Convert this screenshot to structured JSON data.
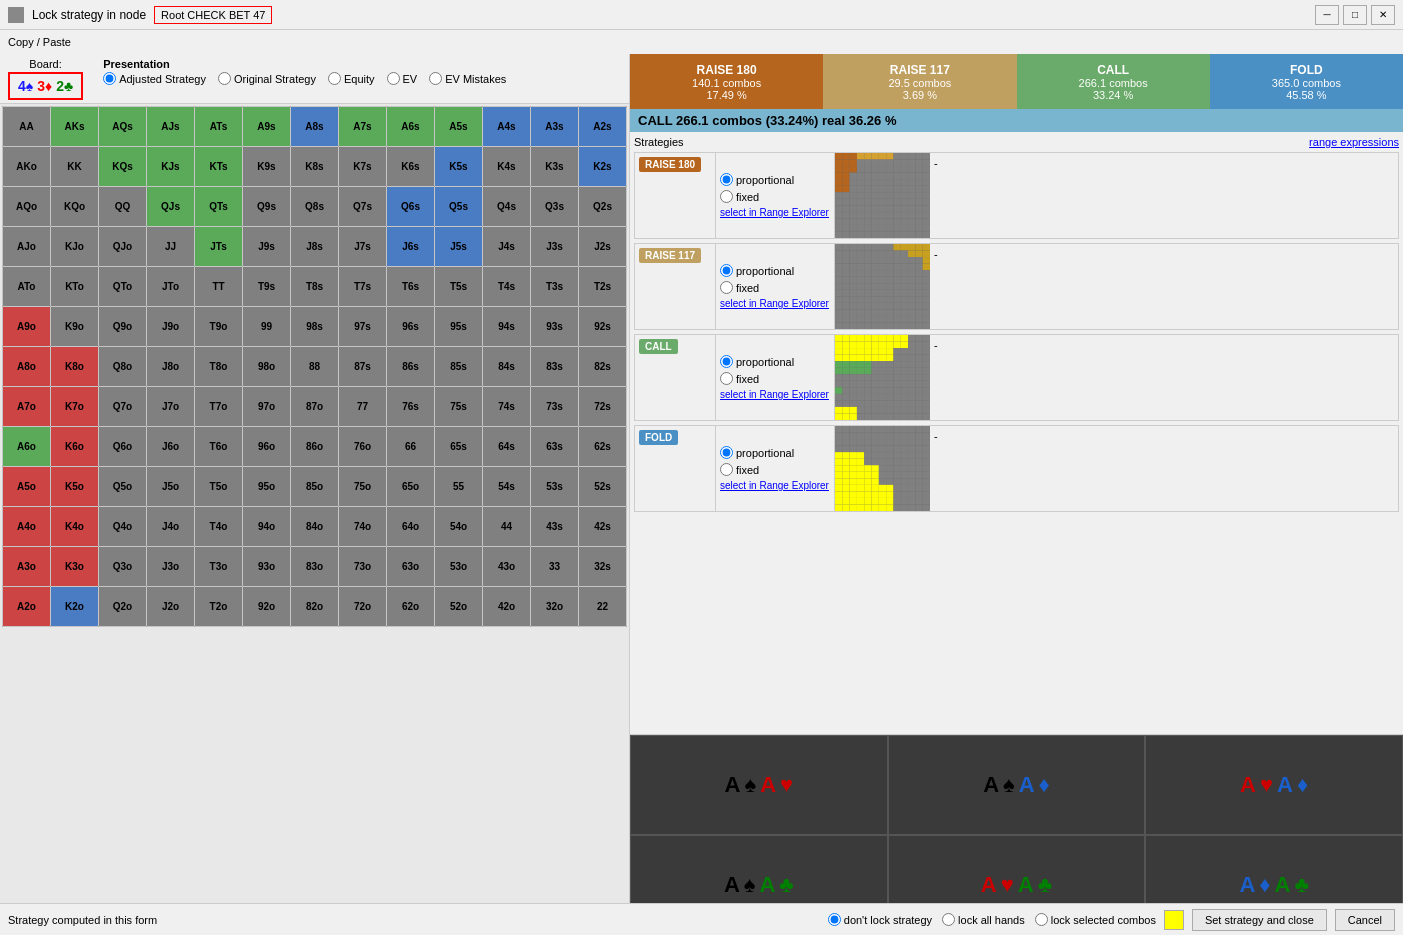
{
  "window": {
    "title": "Lock strategy in node",
    "tab": "Root CHECK BET 47"
  },
  "menu": {
    "copy_paste": "Copy / Paste"
  },
  "board": {
    "label": "Board:",
    "cards": [
      {
        "rank": "4",
        "suit": "♠",
        "suit_name": "spade",
        "color": "#1a1aff"
      },
      {
        "rank": "3",
        "suit": "♦",
        "suit_name": "diamond",
        "color": "#ff0000"
      },
      {
        "rank": "2",
        "suit": "♣",
        "suit_name": "club",
        "color": "#008000"
      }
    ]
  },
  "presentation": {
    "label": "Presentation",
    "options": [
      {
        "id": "adjusted",
        "label": "Adjusted Strategy",
        "checked": true
      },
      {
        "id": "original",
        "label": "Original Strategy",
        "checked": false
      },
      {
        "id": "equity",
        "label": "Equity",
        "checked": false
      },
      {
        "id": "ev",
        "label": "EV",
        "checked": false
      },
      {
        "id": "ev-mistakes",
        "label": "EV Mistakes",
        "checked": false
      }
    ]
  },
  "stats": [
    {
      "label": "RAISE 180",
      "combos": "140.1 combos",
      "pct": "17.49 %",
      "class": "stat-raise180"
    },
    {
      "label": "RAISE 117",
      "combos": "29.5 combos",
      "pct": "3.69 %",
      "class": "stat-raise117"
    },
    {
      "label": "CALL",
      "combos": "266.1 combos",
      "pct": "33.24 %",
      "class": "stat-call"
    },
    {
      "label": "FOLD",
      "combos": "365.0 combos",
      "pct": "45.58 %",
      "class": "stat-fold"
    }
  ],
  "info_bar": {
    "text": "CALL   266.1 combos (33.24%) real  36.26 %"
  },
  "strategies": {
    "title": "Strategies",
    "range_expressions": "range expressions",
    "rows": [
      {
        "id": "raise180",
        "label": "RAISE 180",
        "badge_class": "badge-raise180",
        "proportional": true,
        "fixed": false,
        "select_label": "select in Range Explorer"
      },
      {
        "id": "raise117",
        "label": "RAISE 117",
        "badge_class": "badge-raise117",
        "proportional": true,
        "fixed": false,
        "select_label": "select in Range Explorer"
      },
      {
        "id": "call",
        "label": "CALL",
        "badge_class": "badge-call",
        "proportional": true,
        "fixed": false,
        "select_label": "select in Range Explorer"
      },
      {
        "id": "fold",
        "label": "FOLD",
        "badge_class": "badge-fold",
        "proportional": true,
        "fixed": false,
        "select_label": "select in Range Explorer"
      }
    ]
  },
  "combos": [
    {
      "suits": "A♠A♥",
      "parts": [
        {
          "text": "A",
          "color": "#000"
        },
        {
          "text": "♠",
          "color": "#000"
        },
        {
          "text": "A",
          "color": "#cc0000"
        },
        {
          "text": "♥",
          "color": "#cc0000"
        }
      ]
    },
    {
      "suits": "A♠A♦",
      "parts": [
        {
          "text": "A",
          "color": "#000"
        },
        {
          "text": "♠",
          "color": "#000"
        },
        {
          "text": "A",
          "color": "#1a5fcc"
        },
        {
          "text": "♦",
          "color": "#1a5fcc"
        }
      ]
    },
    {
      "suits": "A♥A♦",
      "parts": [
        {
          "text": "A",
          "color": "#cc0000"
        },
        {
          "text": "♥",
          "color": "#cc0000"
        },
        {
          "text": "A",
          "color": "#1a5fcc"
        },
        {
          "text": "♦",
          "color": "#1a5fcc"
        }
      ]
    },
    {
      "suits": "A♠A♣",
      "parts": [
        {
          "text": "A",
          "color": "#000"
        },
        {
          "text": "♠",
          "color": "#000"
        },
        {
          "text": "A",
          "color": "#008000"
        },
        {
          "text": "♣",
          "color": "#008000"
        }
      ]
    },
    {
      "suits": "A♥A♣",
      "parts": [
        {
          "text": "A",
          "color": "#cc0000"
        },
        {
          "text": "♥",
          "color": "#cc0000"
        },
        {
          "text": "A",
          "color": "#008000"
        },
        {
          "text": "♣",
          "color": "#008000"
        }
      ]
    },
    {
      "suits": "A♦A♣",
      "parts": [
        {
          "text": "A",
          "color": "#1a5fcc"
        },
        {
          "text": "♦",
          "color": "#1a5fcc"
        },
        {
          "text": "A",
          "color": "#008000"
        },
        {
          "text": "♣",
          "color": "#008000"
        }
      ]
    }
  ],
  "bottom": {
    "status": "Strategy computed in this form",
    "lock_options": [
      {
        "label": "don't lock strategy",
        "value": "no-lock",
        "checked": true
      },
      {
        "label": "lock all hands",
        "value": "lock-all",
        "checked": false
      },
      {
        "label": "lock selected combos",
        "value": "lock-selected",
        "checked": false
      }
    ],
    "set_button": "Set strategy and close",
    "cancel_button": "Cancel"
  },
  "grid": {
    "rows": [
      [
        "AA",
        "AKs",
        "AQs",
        "AJs",
        "ATs",
        "A9s",
        "A8s",
        "A7s",
        "A6s",
        "A5s",
        "A4s",
        "A3s",
        "A2s"
      ],
      [
        "AKo",
        "KK",
        "KQs",
        "KJs",
        "KTs",
        "K9s",
        "K8s",
        "K7s",
        "K6s",
        "K5s",
        "K4s",
        "K3s",
        "K2s"
      ],
      [
        "AQo",
        "KQo",
        "QQ",
        "QJs",
        "QTs",
        "Q9s",
        "Q8s",
        "Q7s",
        "Q6s",
        "Q5s",
        "Q4s",
        "Q3s",
        "Q2s"
      ],
      [
        "AJo",
        "KJo",
        "QJo",
        "JJ",
        "JTs",
        "J9s",
        "J8s",
        "J7s",
        "J6s",
        "J5s",
        "J4s",
        "J3s",
        "J2s"
      ],
      [
        "ATo",
        "KTo",
        "QTo",
        "JTo",
        "TT",
        "T9s",
        "T8s",
        "T7s",
        "T6s",
        "T5s",
        "T4s",
        "T3s",
        "T2s"
      ],
      [
        "A9o",
        "K9o",
        "Q9o",
        "J9o",
        "T9o",
        "99",
        "98s",
        "97s",
        "96s",
        "95s",
        "94s",
        "93s",
        "92s"
      ],
      [
        "A8o",
        "K8o",
        "Q8o",
        "J8o",
        "T8o",
        "98o",
        "88",
        "87s",
        "86s",
        "85s",
        "84s",
        "83s",
        "82s"
      ],
      [
        "A7o",
        "K7o",
        "Q7o",
        "J7o",
        "T7o",
        "97o",
        "87o",
        "77",
        "76s",
        "75s",
        "74s",
        "73s",
        "72s"
      ],
      [
        "A6o",
        "K6o",
        "Q6o",
        "J6o",
        "T6o",
        "96o",
        "86o",
        "76o",
        "66",
        "65s",
        "64s",
        "63s",
        "62s"
      ],
      [
        "A5o",
        "K5o",
        "Q5o",
        "J5o",
        "T5o",
        "95o",
        "85o",
        "75o",
        "65o",
        "55",
        "54s",
        "53s",
        "52s"
      ],
      [
        "A4o",
        "K4o",
        "Q4o",
        "J4o",
        "T4o",
        "94o",
        "84o",
        "74o",
        "64o",
        "54o",
        "44",
        "43s",
        "42s"
      ],
      [
        "A3o",
        "K3o",
        "Q3o",
        "J3o",
        "T3o",
        "93o",
        "83o",
        "73o",
        "63o",
        "53o",
        "43o",
        "33",
        "32s"
      ],
      [
        "A2o",
        "K2o",
        "Q2o",
        "J2o",
        "T2o",
        "92o",
        "82o",
        "72o",
        "62o",
        "52o",
        "42o",
        "32o",
        "22"
      ]
    ],
    "colors": [
      [
        "c-gray",
        "c-green",
        "c-green",
        "c-green",
        "c-green",
        "c-green",
        "c-blue",
        "c-green",
        "c-green",
        "c-green",
        "c-blue",
        "c-blue",
        "c-blue"
      ],
      [
        "c-gray",
        "c-gray",
        "c-green",
        "c-green",
        "c-green",
        "c-gray",
        "c-gray",
        "c-gray",
        "c-gray",
        "c-blue",
        "c-gray",
        "c-gray",
        "c-blue"
      ],
      [
        "c-gray",
        "c-gray",
        "c-gray",
        "c-green",
        "c-green",
        "c-gray",
        "c-gray",
        "c-gray",
        "c-blue",
        "c-blue",
        "c-gray",
        "c-gray",
        "c-gray"
      ],
      [
        "c-gray",
        "c-gray",
        "c-gray",
        "c-gray",
        "c-green",
        "c-gray",
        "c-gray",
        "c-gray",
        "c-blue",
        "c-blue",
        "c-gray",
        "c-gray",
        "c-gray"
      ],
      [
        "c-gray",
        "c-gray",
        "c-gray",
        "c-gray",
        "c-gray",
        "c-gray",
        "c-gray",
        "c-gray",
        "c-gray",
        "c-gray",
        "c-gray",
        "c-gray",
        "c-gray"
      ],
      [
        "c-red",
        "c-gray",
        "c-gray",
        "c-gray",
        "c-gray",
        "c-gray",
        "c-gray",
        "c-gray",
        "c-gray",
        "c-gray",
        "c-gray",
        "c-gray",
        "c-gray"
      ],
      [
        "c-red",
        "c-red",
        "c-gray",
        "c-gray",
        "c-gray",
        "c-gray",
        "c-gray",
        "c-gray",
        "c-gray",
        "c-gray",
        "c-gray",
        "c-gray",
        "c-gray"
      ],
      [
        "c-red",
        "c-red",
        "c-gray",
        "c-gray",
        "c-gray",
        "c-gray",
        "c-gray",
        "c-gray",
        "c-gray",
        "c-gray",
        "c-gray",
        "c-gray",
        "c-gray"
      ],
      [
        "c-green",
        "c-red",
        "c-gray",
        "c-gray",
        "c-gray",
        "c-gray",
        "c-gray",
        "c-gray",
        "c-gray",
        "c-gray",
        "c-gray",
        "c-gray",
        "c-gray"
      ],
      [
        "c-red",
        "c-red",
        "c-gray",
        "c-gray",
        "c-gray",
        "c-gray",
        "c-gray",
        "c-gray",
        "c-gray",
        "c-gray",
        "c-gray",
        "c-gray",
        "c-gray"
      ],
      [
        "c-red",
        "c-red",
        "c-gray",
        "c-gray",
        "c-gray",
        "c-gray",
        "c-gray",
        "c-gray",
        "c-gray",
        "c-gray",
        "c-gray",
        "c-gray",
        "c-gray"
      ],
      [
        "c-red",
        "c-red",
        "c-gray",
        "c-gray",
        "c-gray",
        "c-gray",
        "c-gray",
        "c-gray",
        "c-gray",
        "c-gray",
        "c-gray",
        "c-gray",
        "c-gray"
      ],
      [
        "c-red",
        "c-blue",
        "c-gray",
        "c-gray",
        "c-gray",
        "c-gray",
        "c-gray",
        "c-gray",
        "c-gray",
        "c-gray",
        "c-gray",
        "c-gray",
        "c-gray"
      ]
    ]
  }
}
